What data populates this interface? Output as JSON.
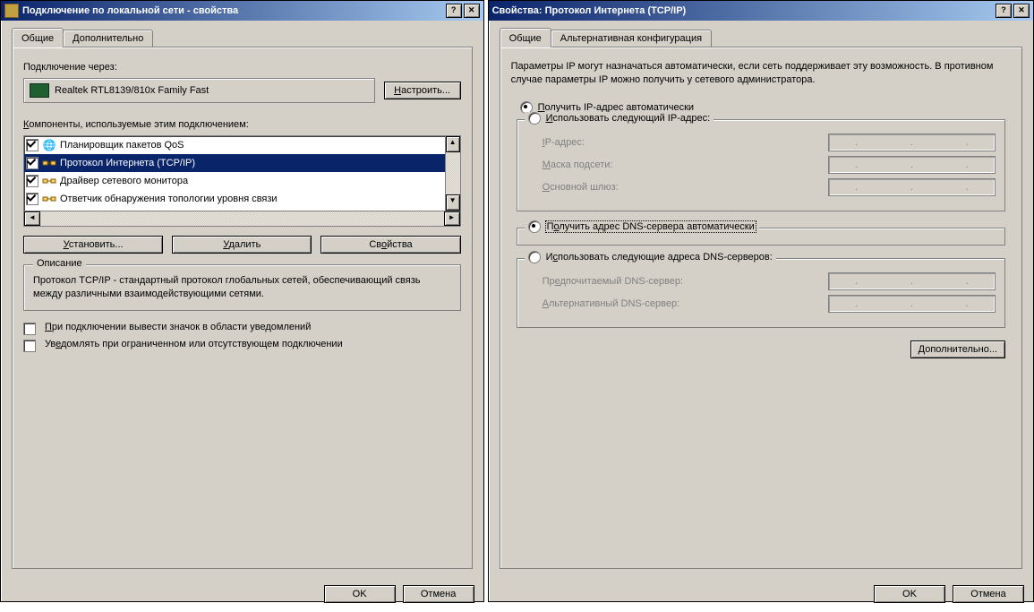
{
  "left": {
    "title": "Подключение по локальной сети - свойства",
    "tabs": {
      "general": "Общие",
      "advanced": "Дополнительно"
    },
    "connect_via_label": "Подключение через:",
    "adapter": "Realtek RTL8139/810x Family Fast",
    "configure_btn": "Настроить...",
    "components_label": "Компоненты, используемые этим подключением:",
    "items": [
      {
        "label": "Планировщик пакетов QoS",
        "checked": true,
        "icon": "🌐",
        "selected": false
      },
      {
        "label": "Протокол Интернета (TCP/IP)",
        "checked": true,
        "icon": "network",
        "selected": true
      },
      {
        "label": "Драйвер сетевого монитора",
        "checked": true,
        "icon": "network",
        "selected": false
      },
      {
        "label": "Ответчик обнаружения топологии уровня связи",
        "checked": true,
        "icon": "network",
        "selected": false
      }
    ],
    "install_btn": "Установить...",
    "uninstall_btn": "Удалить",
    "properties_btn": "Свойства",
    "description_legend": "Описание",
    "description_text": "Протокол TCP/IP - стандартный протокол глобальных сетей, обеспечивающий связь между различными взаимодействующими сетями.",
    "chk_show_icon": "При подключении вывести значок в области уведомлений",
    "chk_notify": "Уведомлять при ограниченном или отсутствующем подключении",
    "ok": "OK",
    "cancel": "Отмена"
  },
  "right": {
    "title": "Свойства: Протокол Интернета (TCP/IP)",
    "tabs": {
      "general": "Общие",
      "alt": "Альтернативная конфигурация"
    },
    "info": "Параметры IP могут назначаться автоматически, если сеть поддерживает эту возможность. В противном случае параметры IP можно получить у сетевого администратора.",
    "radio_ip_auto": "Получить IP-адрес автоматически",
    "radio_ip_manual": "Использовать следующий IP-адрес:",
    "ip_label": "IP-адрес:",
    "mask_label": "Маска подсети:",
    "gateway_label": "Основной шлюз:",
    "radio_dns_auto": "Получить адрес DNS-сервера автоматически",
    "radio_dns_manual": "Использовать следующие адреса DNS-серверов:",
    "dns_pref_label": "Предпочитаемый DNS-сервер:",
    "dns_alt_label": "Альтернативный DNS-сервер:",
    "advanced_btn": "Дополнительно...",
    "ok": "OK",
    "cancel": "Отмена"
  }
}
